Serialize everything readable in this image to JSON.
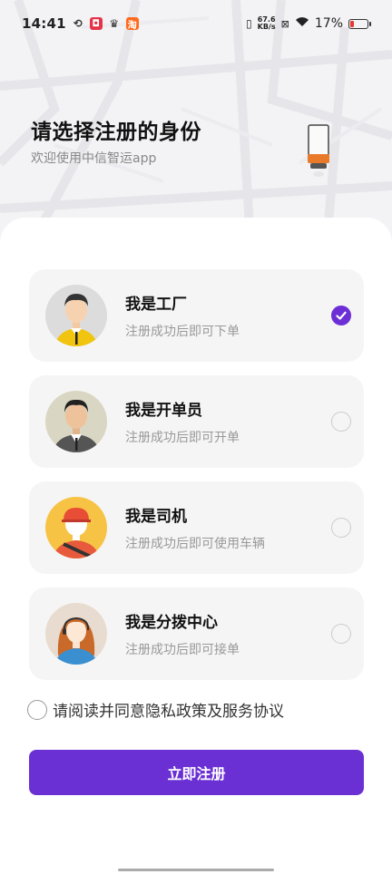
{
  "status_bar": {
    "time": "14:41",
    "net_speed_value": "67.6",
    "net_speed_unit": "KB/s",
    "battery": "17%"
  },
  "header": {
    "title": "请选择注册的身份",
    "subtitle": "欢迎使用中信智运app"
  },
  "roles": [
    {
      "title": "我是工厂",
      "desc": "注册成功后即可下单",
      "selected": true
    },
    {
      "title": "我是开单员",
      "desc": "注册成功后即可开单",
      "selected": false
    },
    {
      "title": "我是司机",
      "desc": "注册成功后即可使用车辆",
      "selected": false
    },
    {
      "title": "我是分拨中心",
      "desc": "注册成功后即可接单",
      "selected": false
    }
  ],
  "agreement": {
    "text": "请阅读并同意隐私政策及服务协议",
    "checked": false
  },
  "register_button": "立即注册",
  "colors": {
    "accent": "#6a30d4",
    "battery_low": "#e53935"
  }
}
